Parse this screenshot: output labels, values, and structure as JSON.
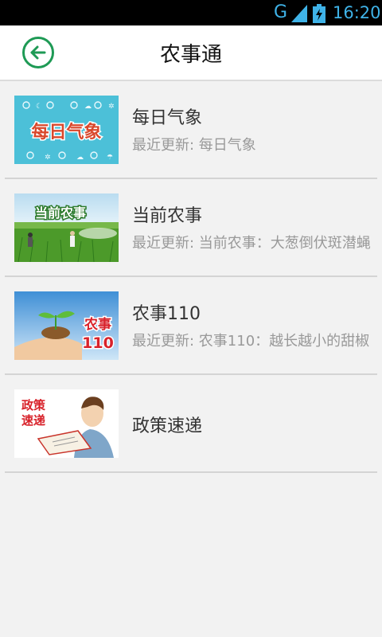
{
  "status_bar": {
    "network": "G",
    "time": "16:20"
  },
  "header": {
    "title": "农事通"
  },
  "items": [
    {
      "title": "每日气象",
      "subtitle": "最近更新: 每日气象",
      "thumb_text": "每日气象"
    },
    {
      "title": "当前农事",
      "subtitle": "最近更新: 当前农事：大葱倒伏斑潜蝇",
      "thumb_text": "当前农事"
    },
    {
      "title": "农事110",
      "subtitle": "最近更新: 农事110：越长越小的甜椒",
      "thumb_text_1": "农事",
      "thumb_text_2": "110"
    },
    {
      "title": "政策速递",
      "thumb_text_1": "政策",
      "thumb_text_2": "速递"
    }
  ],
  "colors": {
    "accent_green": "#1e9a55",
    "status_blue": "#3fb3e8"
  }
}
